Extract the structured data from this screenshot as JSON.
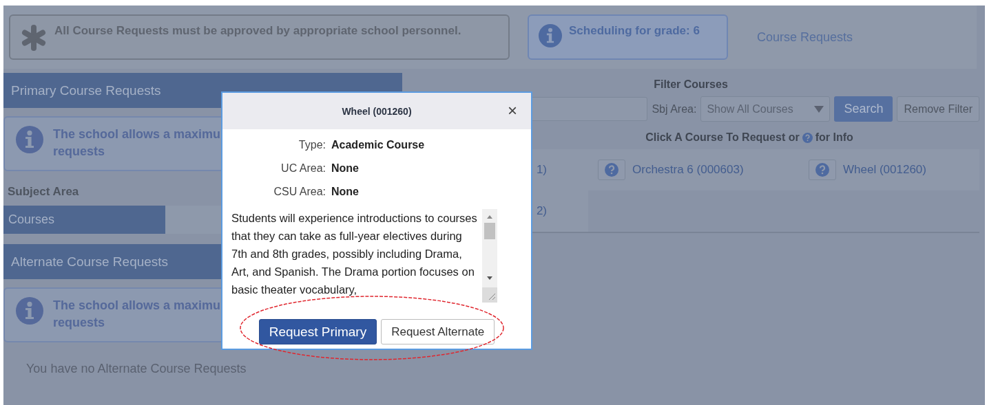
{
  "notices": [
    {
      "kind": "asterisk",
      "text": "All Course Requests must be approved by appropriate school personnel."
    },
    {
      "kind": "info",
      "text": "Scheduling for grade: 6"
    }
  ],
  "top_link": "Course Requests",
  "primary": {
    "title": "Primary Course Requests",
    "info_lines": [
      "The school allows a maximu",
      "requests"
    ]
  },
  "subject_area": {
    "label": "Subject Area",
    "items": [
      {
        "label": "Courses",
        "selected": true
      }
    ]
  },
  "alternate": {
    "title": "Alternate Course Requests",
    "info_lines": [
      "The school allows a maximu",
      "requests"
    ],
    "empty": "You have no Alternate Course Requests"
  },
  "filter": {
    "title": "Filter Courses",
    "sbj_label": "Sbj Area:",
    "sbj_value": "Show All Courses",
    "search": "Search",
    "remove": "Remove Filter",
    "hint_before": "Click A Course To Request or",
    "hint_after": "for Info"
  },
  "courses": [
    [
      {
        "name": "1)",
        "help": false
      },
      {
        "name": "Orchestra 6 (000603)",
        "help": true
      },
      {
        "name": "Wheel (001260)",
        "help": true
      }
    ],
    [
      {
        "name": "2)",
        "help": false
      }
    ]
  ],
  "modal": {
    "title": "Wheel (001260)",
    "close": "×",
    "fields": [
      {
        "label": "Type:",
        "value": "Academic Course"
      },
      {
        "label": "UC Area:",
        "value": "None"
      },
      {
        "label": "CSU Area:",
        "value": "None"
      }
    ],
    "description": "Students will experience introductions to courses that they can take as full-year electives during 7th and 8th grades, possibly including Drama, Art, and Spanish. The Drama portion focuses on basic theater vocabulary,",
    "buttons": [
      {
        "label": "Request Primary",
        "kind": "primary"
      },
      {
        "label": "Request Alternate",
        "kind": "secondary"
      }
    ]
  }
}
